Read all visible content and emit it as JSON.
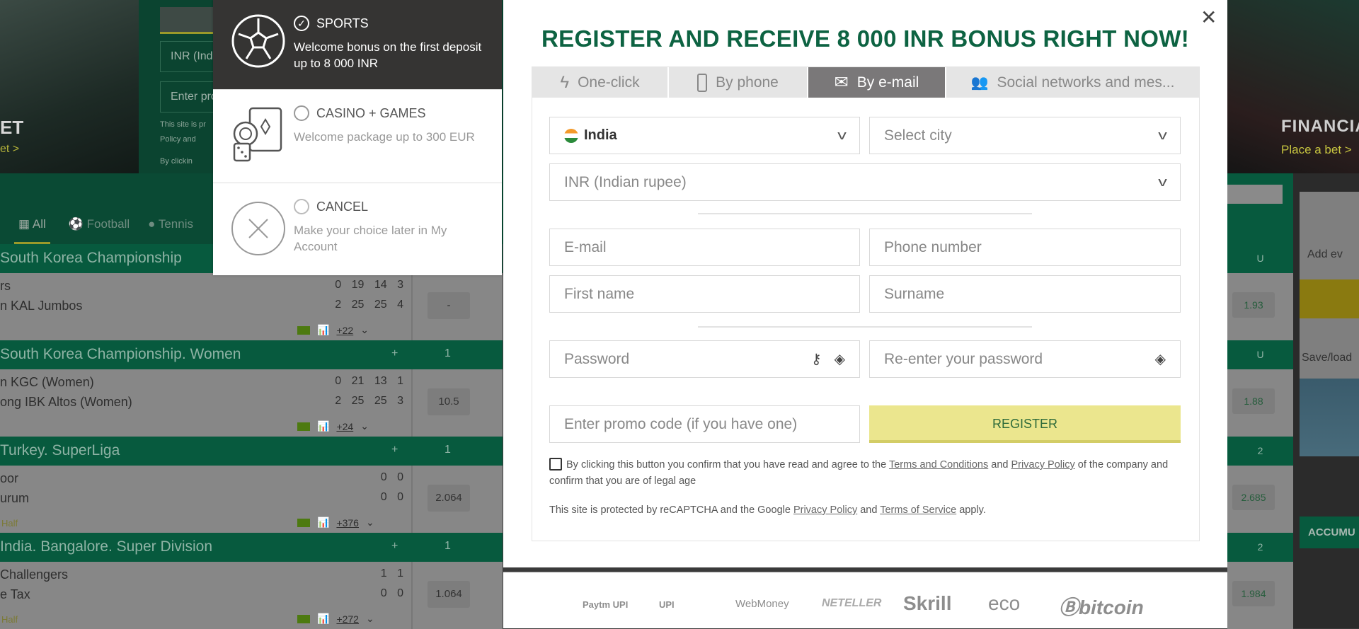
{
  "background": {
    "hero": {
      "title_fragment": "ET",
      "link_fragment": "et >"
    },
    "reg_panel": {
      "currency_fragment": "INR (Ind",
      "promo_fragment": "Enter pro",
      "site_fragment": "This site is pr",
      "policy_fragment": "Policy and",
      "by_clicking_fragment": "By clickin"
    },
    "sport_tabs": [
      {
        "label": "All",
        "icon": "grid-icon"
      },
      {
        "label": "Football",
        "icon": "football-icon"
      },
      {
        "label": "Tennis",
        "icon": "tennis-icon"
      }
    ],
    "leagues": [
      {
        "name": "South Korea Championship",
        "plus": "+",
        "count": "",
        "team1": "rs",
        "team2": "n KAL Jumbos",
        "scores1": "0 19 14 3",
        "scores2": "2 25 25 4",
        "odd": "-",
        "more": "+22",
        "half": "",
        "right_head": "U",
        "right_odd": "1.93"
      },
      {
        "name": "South Korea Championship. Women",
        "plus": "+",
        "count": "1",
        "team1": "n KGC (Women)",
        "team2": "ong IBK Altos (Women)",
        "scores1": "0 21 13 1",
        "scores2": "2 25 25 3",
        "odd": "10.5",
        "more": "+24",
        "half": "",
        "right_head": "U",
        "right_odd": "1.88"
      },
      {
        "name": "Turkey. SuperLiga",
        "plus": "+",
        "count": "1",
        "team1": "oor",
        "team2": "urum",
        "scores1": "0 0",
        "scores2": "0 0",
        "odd": "2.064",
        "more": "+376",
        "half": "Half",
        "right_head": "2",
        "right_odd": "2.685"
      },
      {
        "name": "India. Bangalore. Super Division",
        "plus": "+",
        "count": "1",
        "team1": "Challengers",
        "team2": "e Tax",
        "scores1": "1 1",
        "scores2": "0 0",
        "odd": "1.064",
        "more": "+272",
        "half": "Half",
        "right_head": "2",
        "right_odd": "1.984"
      }
    ],
    "right_banner": {
      "title_fragment": "FINANCIA",
      "link": "Place a bet >"
    },
    "widgets": {
      "add_fragment": "Add ev",
      "save_fragment": "Save/load",
      "accum_fragment": "ACCUMU"
    }
  },
  "bonus_options": [
    {
      "title": "SPORTS",
      "desc": "Welcome bonus on the first deposit up to 8 000 INR",
      "selected": true,
      "icon": "soccer-ball-icon"
    },
    {
      "title": "CASINO + GAMES",
      "desc": "Welcome package up to 300 EUR",
      "selected": false,
      "icon": "casino-chips-icon"
    },
    {
      "title": "CANCEL",
      "desc": "Make your choice later in My Account",
      "selected": false,
      "icon": "cancel-circle-icon"
    }
  ],
  "modal": {
    "title": "REGISTER AND RECEIVE 8 000 INR BONUS RIGHT NOW!",
    "tabs": [
      {
        "label": "One-click",
        "icon": "lightning-icon",
        "active": false
      },
      {
        "label": "By phone",
        "icon": "phone-icon",
        "active": false
      },
      {
        "label": "By e-mail",
        "icon": "envelope-icon",
        "active": true
      },
      {
        "label": "Social networks and mes...",
        "icon": "users-icon",
        "active": false
      }
    ],
    "country": "India",
    "city_placeholder": "Select city",
    "currency": "INR (Indian rupee)",
    "email_placeholder": "E-mail",
    "phone_placeholder": "Phone number",
    "first_name_placeholder": "First name",
    "surname_placeholder": "Surname",
    "password_placeholder": "Password",
    "repassword_placeholder": "Re-enter your password",
    "promo_placeholder": "Enter promo code (if you have one)",
    "register_label": "REGISTER",
    "terms": {
      "pre": "By clicking this button you confirm that you have read and agree to the",
      "link1": "Terms and Conditions",
      "and": "and",
      "link2": "Privacy Policy",
      "post": "of the company and confirm that you are of legal age"
    },
    "recaptcha": {
      "pre": "This site is protected by reCAPTCHA and the Google",
      "link1": "Privacy Policy",
      "and": "and",
      "link2": "Terms of Service",
      "post": "apply."
    },
    "payment_logos": [
      "Paytm UPI",
      "UPI",
      "WebMoney",
      "NETELLER",
      "Skrill",
      "eco",
      "bitcoin"
    ],
    "colors": {
      "title": "#0d6342",
      "register_bg": "#ebe68e",
      "active_tab": "#7a7879",
      "selected_option_bg": "#353433"
    }
  }
}
